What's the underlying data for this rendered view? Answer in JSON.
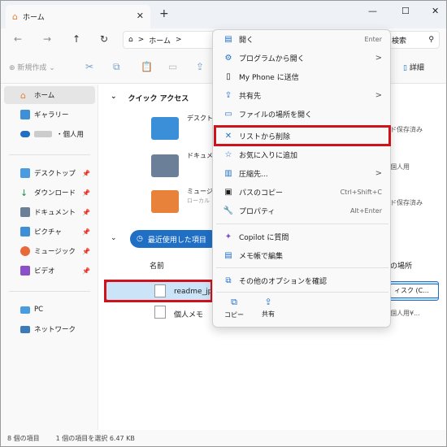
{
  "window": {
    "tab_title": "ホーム",
    "tab_close": "✕",
    "new_tab": "+",
    "controls": {
      "minimize": "—",
      "maximize": "☐",
      "close": "✕"
    }
  },
  "address": {
    "back": "←",
    "forward": "→",
    "up": "↑",
    "refresh": "↻",
    "crumb_home": "ホーム",
    "crumb_sep": ">",
    "search_text": "検索",
    "search_icon": "⚲"
  },
  "toolbar": {
    "new_label": "新規作成",
    "details_label": "詳細"
  },
  "sidebar": {
    "items": [
      {
        "label": "ホーム",
        "icon": "home-icon"
      },
      {
        "label": "ギャラリー",
        "icon": "gallery-icon"
      },
      {
        "label": "・個人用",
        "icon": "onedrive-icon"
      },
      {
        "label": "デスクトップ",
        "icon": "desktop-icon"
      },
      {
        "label": "ダウンロード",
        "icon": "download-icon"
      },
      {
        "label": "ドキュメント",
        "icon": "documents-icon"
      },
      {
        "label": "ピクチャ",
        "icon": "pictures-icon"
      },
      {
        "label": "ミュージック",
        "icon": "music-icon"
      },
      {
        "label": "ビデオ",
        "icon": "videos-icon"
      },
      {
        "label": "PC",
        "icon": "pc-icon"
      },
      {
        "label": "ネットワーク",
        "icon": "network-icon"
      }
    ]
  },
  "main": {
    "quick_access": "クイック アクセス",
    "folders": [
      {
        "name": "デスクト",
        "right": "ド保存済み"
      },
      {
        "name": "ドキュメ",
        "right": "個人用"
      },
      {
        "name": "ミュージ",
        "sub": "ローカル",
        "right": "ド保存済み"
      }
    ],
    "recent": "最近使用した項目",
    "col_name": "名前",
    "col_location": "の場所",
    "files": [
      {
        "name": "readme_jp",
        "location": "ィスク (C..."
      },
      {
        "name": "個人メモ",
        "location": "個人用¥..."
      }
    ]
  },
  "status": {
    "count": "8 個の項目",
    "selected": "1 個の項目を選択  6.47 KB"
  },
  "context_menu": {
    "items": [
      {
        "label": "開く",
        "shortcut": "Enter",
        "icon": "open-icon"
      },
      {
        "label": "プログラムから開く",
        "arrow": ">",
        "icon": "open-with-icon"
      },
      {
        "label": "My Phone に送信",
        "icon": "phone-icon"
      },
      {
        "label": "共有先",
        "arrow": ">",
        "icon": "share-icon"
      },
      {
        "label": "ファイルの場所を開く",
        "icon": "folder-icon"
      },
      {
        "label": "リストから削除",
        "icon": "remove-icon"
      },
      {
        "label": "お気に入りに追加",
        "icon": "star-icon"
      },
      {
        "label": "圧縮先...",
        "arrow": ">",
        "icon": "zip-icon"
      },
      {
        "label": "パスのコピー",
        "shortcut": "Ctrl+Shift+C",
        "icon": "path-icon"
      },
      {
        "label": "プロパティ",
        "shortcut": "Alt+Enter",
        "icon": "properties-icon"
      },
      {
        "label": "Copilot に質問",
        "icon": "copilot-icon"
      },
      {
        "label": "メモ帳で編集",
        "icon": "notepad-icon"
      },
      {
        "label": "その他のオプションを確認",
        "icon": "more-options-icon"
      }
    ],
    "quick_copy": "コピー",
    "quick_share": "共有"
  }
}
